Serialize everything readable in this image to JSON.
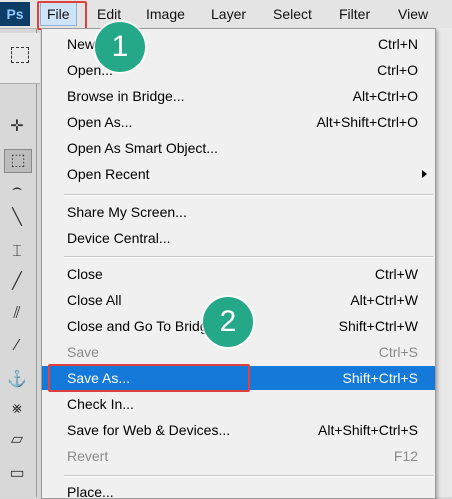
{
  "app": {
    "logo": "Ps"
  },
  "menubar": {
    "items": [
      "File",
      "Edit",
      "Image",
      "Layer",
      "Select",
      "Filter",
      "View"
    ]
  },
  "file_menu": {
    "groups": [
      [
        {
          "label": "New...",
          "shortcut": "Ctrl+N"
        },
        {
          "label": "Open...",
          "shortcut": "Ctrl+O"
        },
        {
          "label": "Browse in Bridge...",
          "shortcut": "Alt+Ctrl+O"
        },
        {
          "label": "Open As...",
          "shortcut": "Alt+Shift+Ctrl+O"
        },
        {
          "label": "Open As Smart Object...",
          "shortcut": ""
        },
        {
          "label": "Open Recent",
          "shortcut": "",
          "submenu": true
        }
      ],
      [
        {
          "label": "Share My Screen...",
          "shortcut": ""
        },
        {
          "label": "Device Central...",
          "shortcut": ""
        }
      ],
      [
        {
          "label": "Close",
          "shortcut": "Ctrl+W"
        },
        {
          "label": "Close All",
          "shortcut": "Alt+Ctrl+W"
        },
        {
          "label": "Close and Go To Bridge...",
          "shortcut": "Shift+Ctrl+W"
        },
        {
          "label": "Save",
          "shortcut": "Ctrl+S",
          "disabled": true
        },
        {
          "label": "Save As...",
          "shortcut": "Shift+Ctrl+S",
          "highlighted": true
        },
        {
          "label": "Check In...",
          "shortcut": ""
        },
        {
          "label": "Save for Web & Devices...",
          "shortcut": "Alt+Shift+Ctrl+S"
        },
        {
          "label": "Revert",
          "shortcut": "F12",
          "disabled": true
        }
      ],
      [
        {
          "label": "Place...",
          "shortcut": ""
        }
      ]
    ]
  },
  "annotations": {
    "step1": "1",
    "step2": "2"
  },
  "colors": {
    "highlight": "#1479d9",
    "callout_box": "#e0413e",
    "step_badge": "#25a887"
  },
  "toolbox": {
    "tools": [
      "move-tool-icon",
      "marquee-tool-icon",
      "lasso-tool-icon",
      "quick-selection-tool-icon",
      "crop-tool-icon",
      "eyedropper-tool-icon",
      "healing-brush-tool-icon",
      "brush-tool-icon",
      "clone-stamp-tool-icon",
      "history-brush-tool-icon",
      "eraser-tool-icon",
      "gradient-tool-icon"
    ]
  }
}
